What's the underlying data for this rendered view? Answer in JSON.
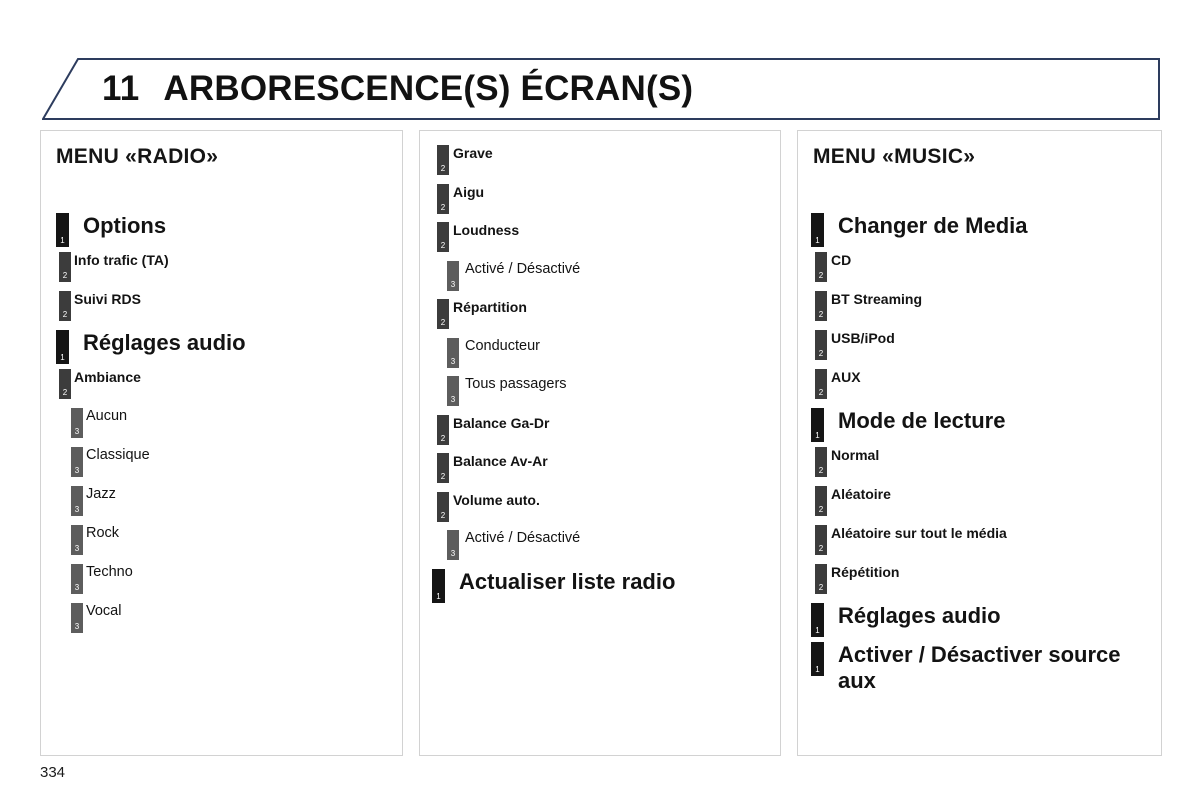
{
  "header": {
    "chapter_number": "11",
    "title": "ARBORESCENCE(S) ÉCRAN(S)",
    "border_color": "#2d3c5e"
  },
  "page_number": "334",
  "level_colors": {
    "level1": "#151515",
    "level2": "#3c3c3c",
    "level3": "#5d5d5d"
  },
  "columns": [
    {
      "title": "MENU «RADIO»",
      "items": [
        {
          "level": "1",
          "label": "Options"
        },
        {
          "level": "2",
          "label": "Info trafic (TA)"
        },
        {
          "level": "2",
          "label": "Suivi RDS"
        },
        {
          "level": "1",
          "label": "Réglages audio"
        },
        {
          "level": "2",
          "label": "Ambiance"
        },
        {
          "level": "3",
          "label": "Aucun"
        },
        {
          "level": "3",
          "label": "Classique"
        },
        {
          "level": "3",
          "label": "Jazz"
        },
        {
          "level": "3",
          "label": "Rock"
        },
        {
          "level": "3",
          "label": "Techno"
        },
        {
          "level": "3",
          "label": "Vocal"
        }
      ]
    },
    {
      "title": "",
      "items": [
        {
          "level": "2",
          "label": "Grave"
        },
        {
          "level": "2",
          "label": "Aigu"
        },
        {
          "level": "2",
          "label": "Loudness"
        },
        {
          "level": "3",
          "label": "Activé / Désactivé"
        },
        {
          "level": "2",
          "label": "Répartition"
        },
        {
          "level": "3",
          "label": "Conducteur"
        },
        {
          "level": "3",
          "label": "Tous passagers"
        },
        {
          "level": "2",
          "label": "Balance Ga-Dr"
        },
        {
          "level": "2",
          "label": "Balance Av-Ar"
        },
        {
          "level": "2",
          "label": "Volume auto."
        },
        {
          "level": "3",
          "label": "Activé / Désactivé"
        },
        {
          "level": "1",
          "label": "Actualiser liste radio"
        }
      ]
    },
    {
      "title": "MENU «MUSIC»",
      "items": [
        {
          "level": "1",
          "label": "Changer de Media"
        },
        {
          "level": "2",
          "label": "CD"
        },
        {
          "level": "2",
          "label": "BT Streaming"
        },
        {
          "level": "2",
          "label": "USB/iPod"
        },
        {
          "level": "2",
          "label": "AUX"
        },
        {
          "level": "1",
          "label": "Mode de lecture"
        },
        {
          "level": "2",
          "label": "Normal"
        },
        {
          "level": "2",
          "label": "Aléatoire"
        },
        {
          "level": "2",
          "label": "Aléatoire sur tout le média"
        },
        {
          "level": "2",
          "label": "Répétition"
        },
        {
          "level": "1",
          "label": "Réglages audio"
        },
        {
          "level": "1",
          "label": "Activer / Désactiver source aux",
          "two_line": true
        }
      ]
    }
  ]
}
